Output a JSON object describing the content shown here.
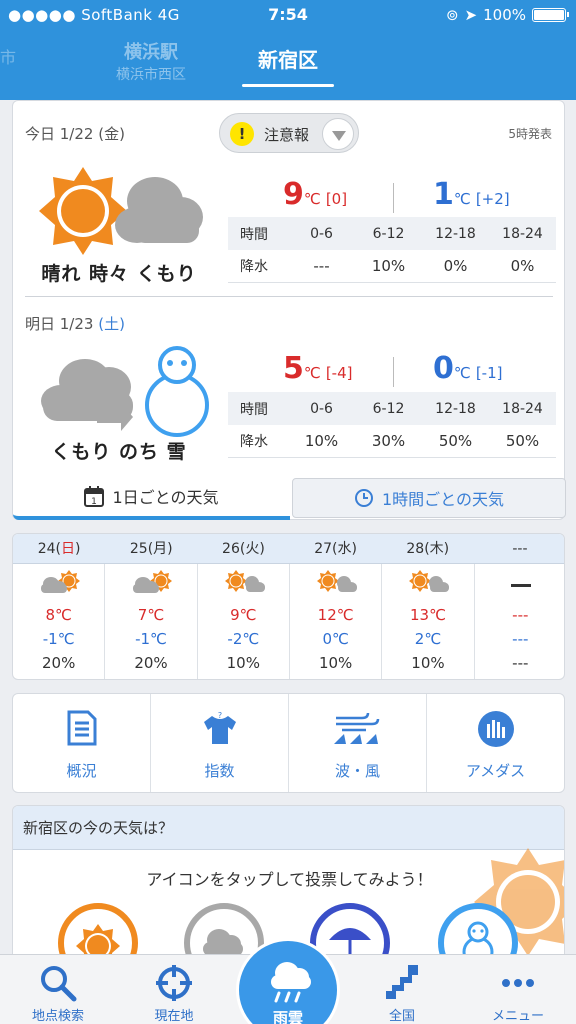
{
  "status_bar": {
    "carrier": "●●●●● SoftBank  4G",
    "time": "7:54",
    "battery": "100%"
  },
  "location_tabs": {
    "far_left": "市",
    "prev_name": "横浜駅",
    "prev_sub": "横浜市西区",
    "current": "新宿区"
  },
  "today": {
    "label_prefix": "今日 1/22 (",
    "weekday": "金",
    "label_suffix": ")",
    "warning": "注意報",
    "announce": "5時発表",
    "weather": "晴れ 時々 くもり",
    "high": "9",
    "high_diff": "[0]",
    "low": "1",
    "low_diff": "[+2]",
    "unit": "℃",
    "header_row": [
      "時間",
      "0-6",
      "6-12",
      "12-18",
      "18-24"
    ],
    "precip_label": "降水",
    "precip": [
      "---",
      "10%",
      "0%",
      "0%"
    ]
  },
  "tomorrow": {
    "label_prefix": "明日 1/23 ",
    "weekday": "(土)",
    "weather": "くもり のち 雪",
    "high": "5",
    "high_diff": "[-4]",
    "low": "0",
    "low_diff": "[-1]",
    "unit": "℃",
    "header_row": [
      "時間",
      "0-6",
      "6-12",
      "12-18",
      "18-24"
    ],
    "precip_label": "降水",
    "precip": [
      "10%",
      "30%",
      "50%",
      "50%"
    ]
  },
  "subtabs": {
    "daily": "1日ごとの天気",
    "hourly": "1時間ごとの天気",
    "cal_num": "1"
  },
  "weekly": [
    {
      "pre": "24(",
      "wd": "日",
      "post": ")",
      "sunday": true,
      "hi": "8℃",
      "lo": "-1℃",
      "pop": "20%",
      "icon": "cloud-sun-icon"
    },
    {
      "pre": "25(",
      "wd": "月",
      "post": ")",
      "sunday": false,
      "hi": "7℃",
      "lo": "-1℃",
      "pop": "20%",
      "icon": "cloud-sun-icon"
    },
    {
      "pre": "26(",
      "wd": "火",
      "post": ")",
      "sunday": false,
      "hi": "9℃",
      "lo": "-2℃",
      "pop": "10%",
      "icon": "sun-cloud-icon"
    },
    {
      "pre": "27(",
      "wd": "水",
      "post": ")",
      "sunday": false,
      "hi": "12℃",
      "lo": "0℃",
      "pop": "10%",
      "icon": "sun-cloud-icon"
    },
    {
      "pre": "28(",
      "wd": "木",
      "post": ")",
      "sunday": false,
      "hi": "13℃",
      "lo": "2℃",
      "pop": "10%",
      "icon": "sun-cloud-icon"
    },
    {
      "pre": "---",
      "wd": "",
      "post": "",
      "sunday": false,
      "hi": "---",
      "lo": "---",
      "pop": "---",
      "icon": "none"
    }
  ],
  "menu": {
    "overview": "概況",
    "index": "指数",
    "wave_wind": "波・風",
    "amedas": "アメダス"
  },
  "vote": {
    "title": "新宿区の今の天気は？",
    "message": "アイコンをタップして投票してみよう！"
  },
  "tabbar": {
    "search": "地点検索",
    "current": "現在地",
    "rain": "雨雲",
    "nation": "全国",
    "menu": "メニュー"
  },
  "colors": {
    "header": "#2f92dc",
    "high": "#d92b2b",
    "low": "#2e6fd2",
    "sun": "#f08a1f",
    "cloud": "#a8a8a8"
  }
}
